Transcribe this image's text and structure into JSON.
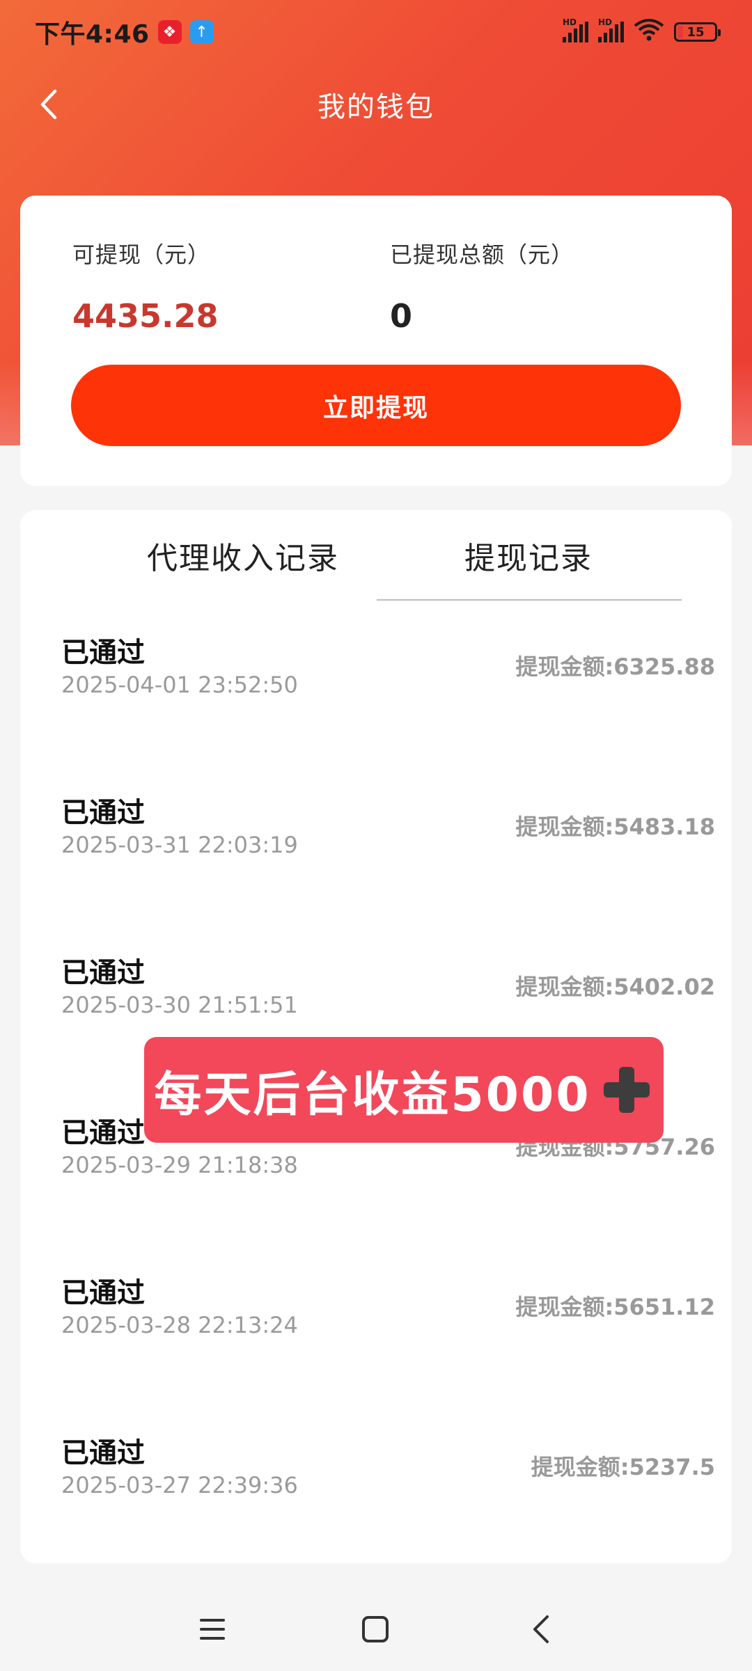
{
  "status_bar": {
    "time": "下午4:46",
    "signal1_label": "HD",
    "signal2_label": "HD",
    "battery_level": "15"
  },
  "header": {
    "title": "我的钱包"
  },
  "wallet": {
    "available_label": "可提现（元）",
    "available_value": "4435.28",
    "withdrawn_total_label": "已提现总额（元）",
    "withdrawn_total_value": "0",
    "withdraw_button_label": "立即提现"
  },
  "tabs": [
    {
      "label": "代理收入记录",
      "active": false
    },
    {
      "label": "提现记录",
      "active": true
    }
  ],
  "records": [
    {
      "status": "已通过",
      "time": "2025-04-01 23:52:50",
      "amount": "提现金额:6325.88"
    },
    {
      "status": "已通过",
      "time": "2025-03-31 22:03:19",
      "amount": "提现金额:5483.18"
    },
    {
      "status": "已通过",
      "time": "2025-03-30 21:51:51",
      "amount": "提现金额:5402.02"
    },
    {
      "status": "已通过",
      "time": "2025-03-29 21:18:38",
      "amount": "提现金额:5757.26"
    },
    {
      "status": "已通过",
      "time": "2025-03-28 22:13:24",
      "amount": "提现金额:5651.12"
    },
    {
      "status": "已通过",
      "time": "2025-03-27 22:39:36",
      "amount": "提现金额:5237.5"
    }
  ],
  "promo": {
    "text": "每天后台收益5000"
  },
  "colors": {
    "header_gradient_start": "#f26a3a",
    "header_gradient_end": "#ec3d33",
    "balance_red": "#c8382e",
    "button_red": "#ff3308",
    "promo_bg": "#f2485a"
  }
}
